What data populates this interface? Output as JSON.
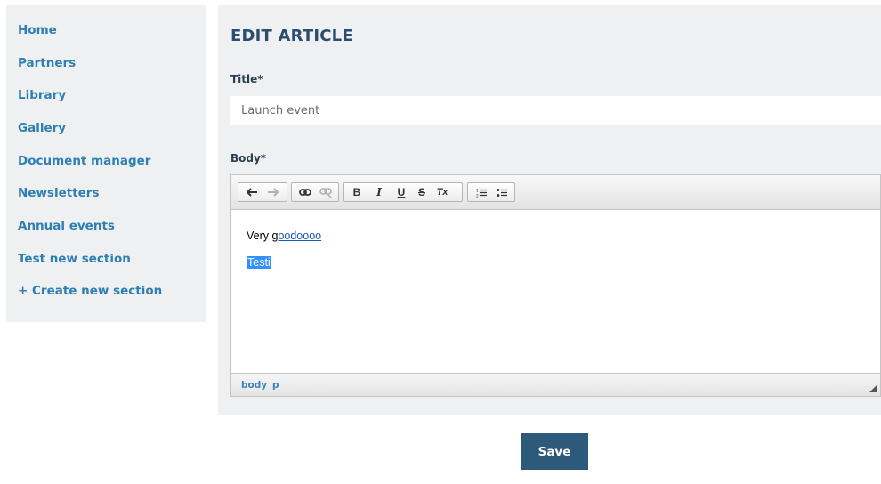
{
  "sidebar": {
    "items": [
      {
        "label": "Home"
      },
      {
        "label": "Partners"
      },
      {
        "label": "Library"
      },
      {
        "label": "Gallery"
      },
      {
        "label": "Document manager"
      },
      {
        "label": "Newsletters"
      },
      {
        "label": "Annual events"
      },
      {
        "label": "Test new section"
      },
      {
        "label": "+ Create new section"
      }
    ]
  },
  "form": {
    "heading": "EDIT ARTICLE",
    "title_label": "Title*",
    "title_value": "Launch event",
    "body_label": "Body*"
  },
  "editor": {
    "toolbar": {
      "history": [
        "undo-icon",
        "redo-icon"
      ],
      "links": [
        "link-icon",
        "unlink-icon"
      ],
      "formatting": [
        {
          "name": "bold",
          "glyph": "B"
        },
        {
          "name": "italic",
          "glyph": "I"
        },
        {
          "name": "underline",
          "glyph": "U"
        },
        {
          "name": "strikethrough",
          "glyph": "S"
        },
        {
          "name": "remove-format",
          "glyph": "Tx"
        }
      ],
      "lists": [
        "numbered-list-icon",
        "bulleted-list-icon"
      ]
    },
    "content": {
      "line1_prefix": "Very g",
      "line1_link": "oodoooo",
      "line2_selected": "Testi"
    },
    "path": [
      "body",
      "p"
    ]
  },
  "actions": {
    "save_label": "Save"
  },
  "colors": {
    "accent": "#2f7fb3",
    "heading": "#2c4d6e",
    "save_button": "#2d5a7b",
    "selection": "#3390ff"
  }
}
